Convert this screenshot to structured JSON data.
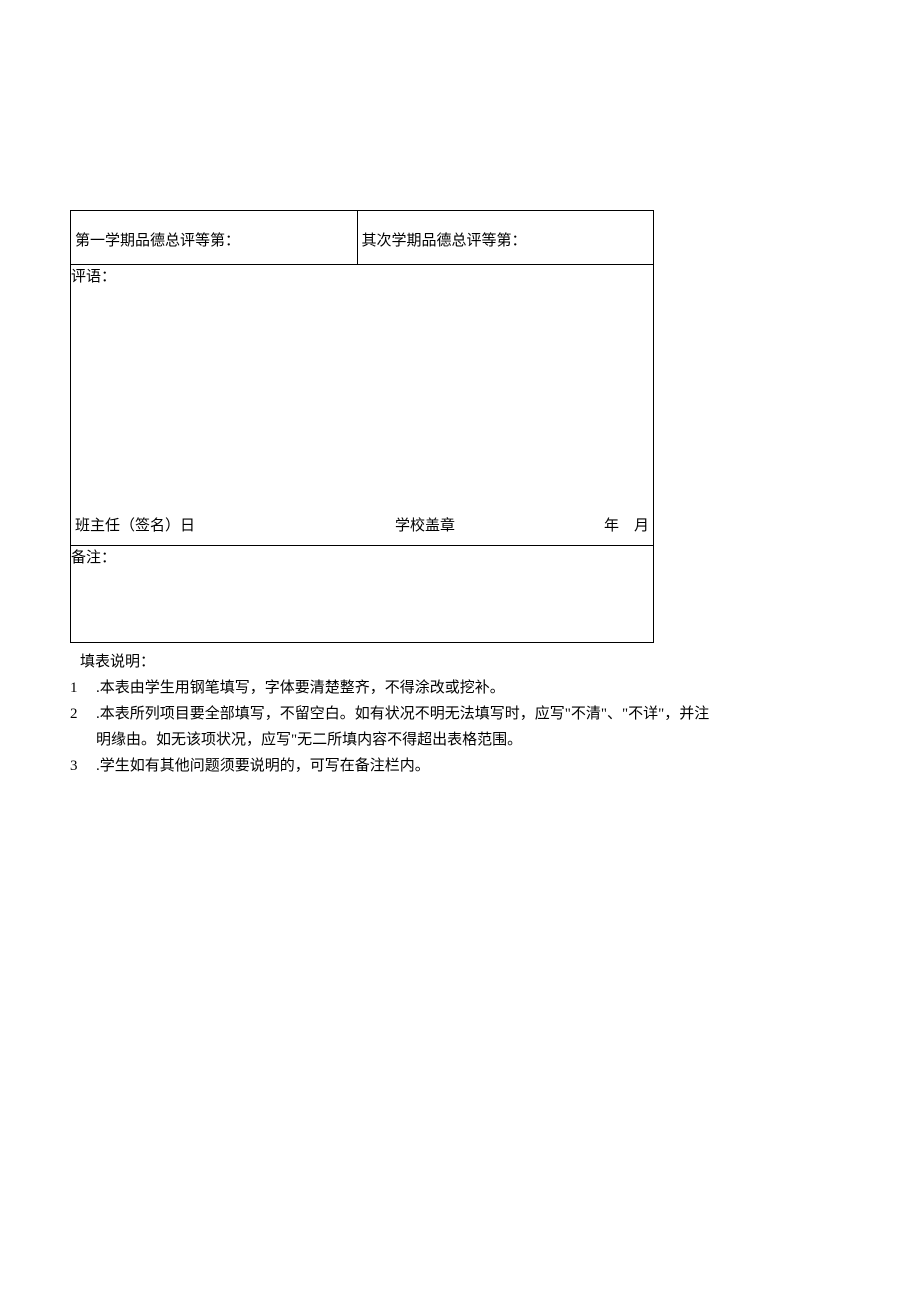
{
  "table": {
    "semester1_label": "第一学期品德总评等第：",
    "semester2_label": "其次学期品德总评等第：",
    "comment_label": "评语：",
    "teacher_sign_label": "班主任（签名）日",
    "school_stamp_label": "学校盖章",
    "year_label": "年",
    "month_label": "月",
    "note_label": "备注："
  },
  "instructions": {
    "heading": "填表说明：",
    "items": [
      {
        "num": "1",
        "text": ".本表由学生用钢笔填写，字体要清楚整齐，不得涂改或挖补。"
      },
      {
        "num": "2",
        "text": ".本表所列项目要全部填写，不留空白。如有状况不明无法填写时，应写\"不清\"、\"不详\"，并注明缘由。如无该项状况，应写\"无二所填内容不得超出表格范围。"
      },
      {
        "num": "3",
        "text": ".学生如有其他问题须要说明的，可写在备注栏内。"
      }
    ]
  }
}
